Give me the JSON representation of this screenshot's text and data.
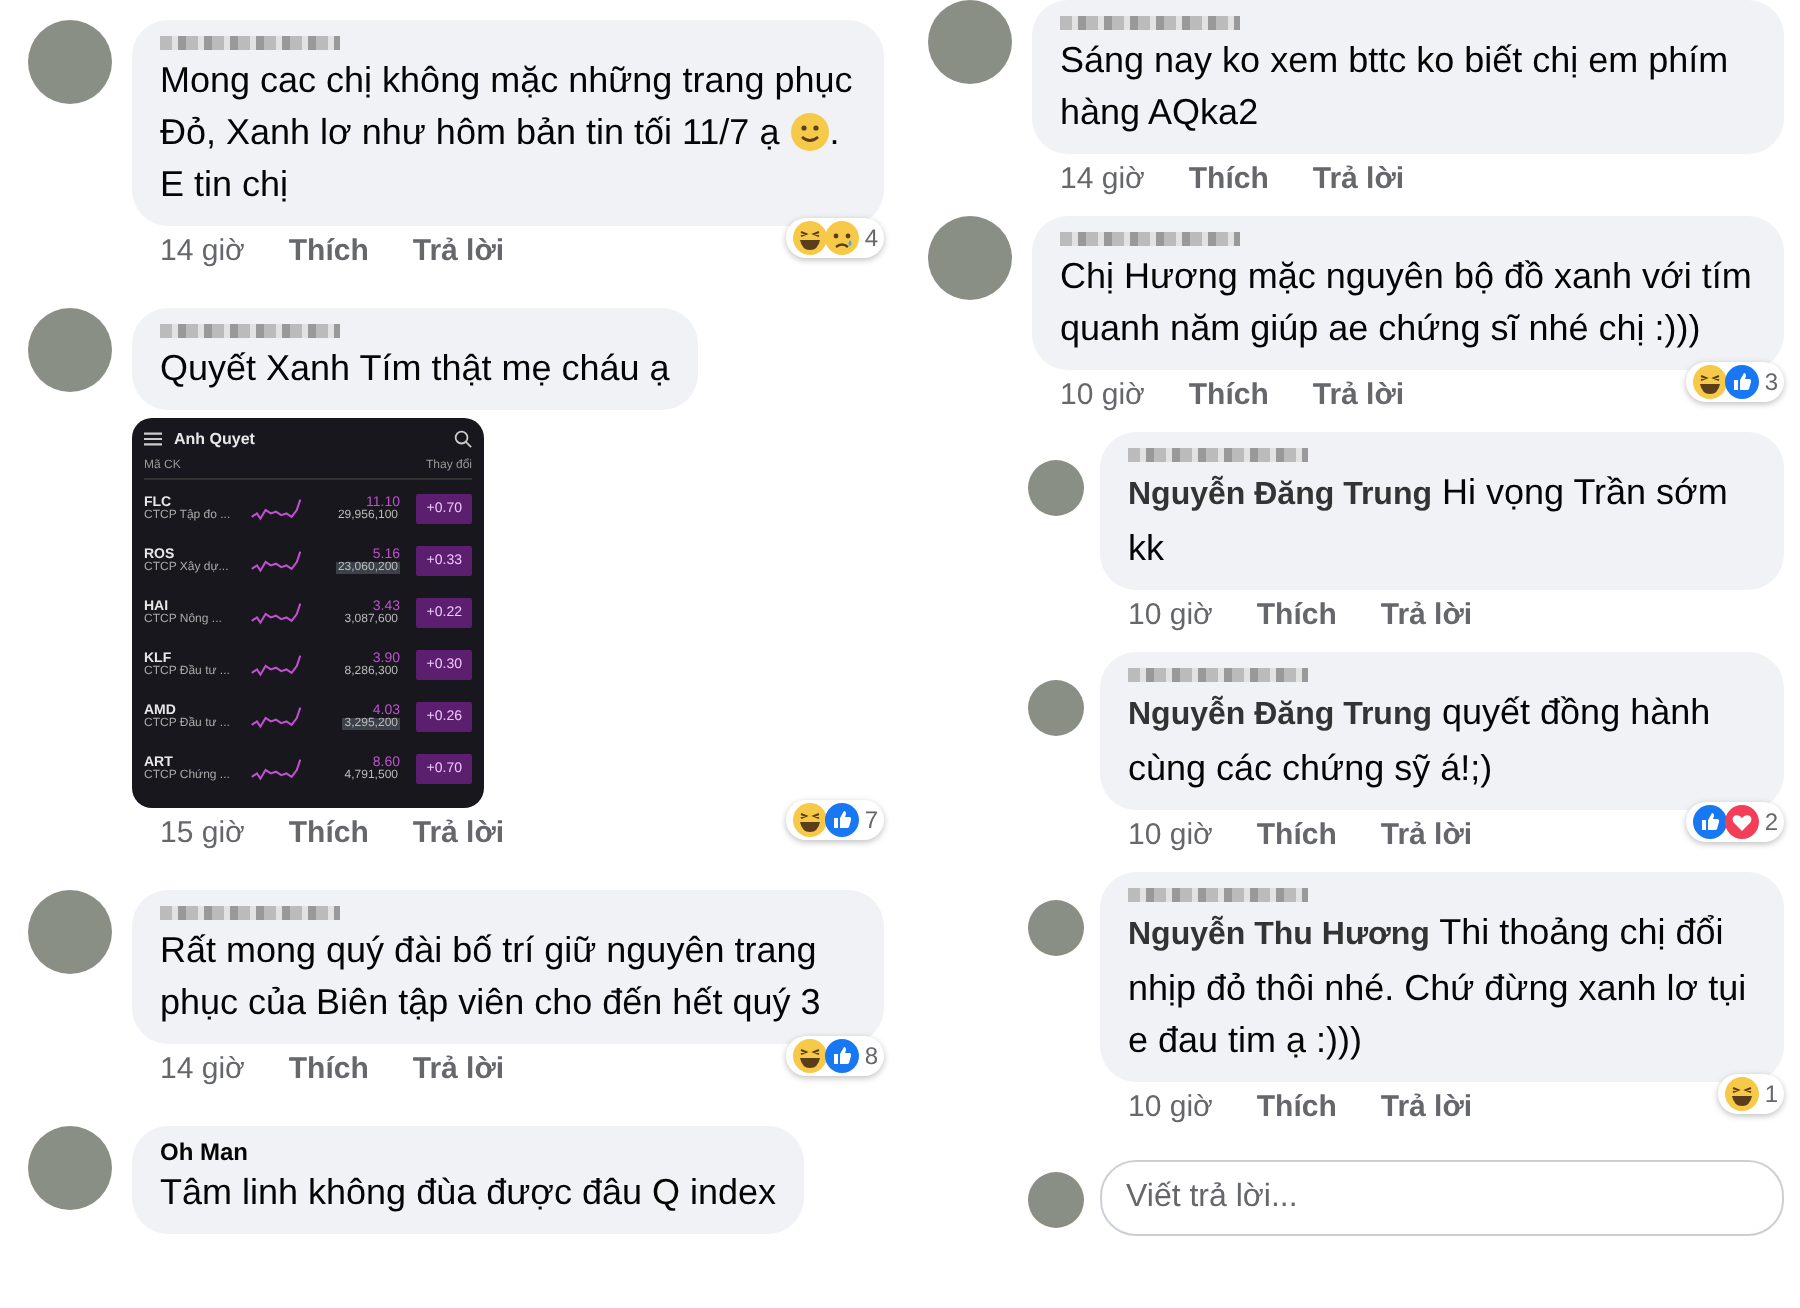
{
  "columns": [
    {
      "comments": [
        {
          "kind": "comment",
          "name_hidden": true,
          "text": [
            {
              "kind": "text",
              "value": "Mong cac chị không mặc những trang phục Đỏ, Xanh lơ như hôm bản tin tối 11/7 ạ "
            },
            {
              "kind": "emoji"
            },
            {
              "kind": "text",
              "value": ". E tin chị"
            }
          ],
          "time": "14 giờ",
          "like": "Thích",
          "reply": "Trả lời",
          "reactions": [
            {
              "kind": "haha"
            },
            {
              "kind": "sad"
            }
          ],
          "reaction_count": "4"
        },
        {
          "kind": "comment",
          "name_hidden": true,
          "text": [
            {
              "kind": "text",
              "value": "Quyết Xanh Tím thật mẹ cháu ạ"
            }
          ],
          "attachment": {
            "title": "Anh Quyet",
            "headers": [
              "Mã CK",
              "Thay đổi"
            ],
            "rows": [
              {
                "ticker": "FLC",
                "company": "CTCP Tập đo ...",
                "price": "11.10",
                "volume": "29,956,100",
                "highlighted": false,
                "change": "+0.70"
              },
              {
                "ticker": "ROS",
                "company": "CTCP Xây dự...",
                "price": "5.16",
                "volume": "23,060,200",
                "highlighted": true,
                "change": "+0.33"
              },
              {
                "ticker": "HAI",
                "company": "CTCP Nông ...",
                "price": "3.43",
                "volume": "3,087,600",
                "highlighted": false,
                "change": "+0.22"
              },
              {
                "ticker": "KLF",
                "company": "CTCP Đầu tư ...",
                "price": "3.90",
                "volume": "8,286,300",
                "highlighted": false,
                "change": "+0.30"
              },
              {
                "ticker": "AMD",
                "company": "CTCP Đầu tư ...",
                "price": "4.03",
                "volume": "3,295,200",
                "highlighted": true,
                "change": "+0.26"
              },
              {
                "ticker": "ART",
                "company": "CTCP Chứng ...",
                "price": "8.60",
                "volume": "4,791,500",
                "highlighted": false,
                "change": "+0.70"
              }
            ]
          },
          "time": "15 giờ",
          "like": "Thích",
          "reply": "Trả lời",
          "reactions": [
            {
              "kind": "haha"
            },
            {
              "kind": "like"
            }
          ],
          "reaction_count": "7"
        },
        {
          "kind": "comment",
          "name_hidden": true,
          "text": [
            {
              "kind": "text",
              "value": "Rất mong quý đài bố trí giữ nguyên trang phục của Biên tập viên cho đến hết quý 3"
            }
          ],
          "time": "14 giờ",
          "like": "Thích",
          "reply": "Trả lời",
          "reactions": [
            {
              "kind": "haha"
            },
            {
              "kind": "like"
            }
          ],
          "reaction_count": "8"
        },
        {
          "kind": "comment",
          "name_hidden": false,
          "name": "Oh Man",
          "text": [
            {
              "kind": "text",
              "value": "Tâm linh không đùa được đâu Q index"
            }
          ]
        }
      ]
    },
    {
      "comments": [
        {
          "kind": "comment",
          "name_hidden": true,
          "text": [
            {
              "kind": "text",
              "value": "Sáng nay ko xem bttc ko biết chị em phím hàng AQka2"
            }
          ],
          "time": "14 giờ",
          "like": "Thích",
          "reply": "Trả lời"
        },
        {
          "kind": "comment",
          "name_hidden": true,
          "text": [
            {
              "kind": "text",
              "value": "Chị Hương mặc nguyên bộ đồ xanh với tím quanh năm giúp ae chứng sĩ nhé chị :)))"
            }
          ],
          "time": "10 giờ",
          "like": "Thích",
          "reply": "Trả lời",
          "reactions": [
            {
              "kind": "haha"
            },
            {
              "kind": "like"
            }
          ],
          "reaction_count": "3"
        },
        {
          "kind": "reply",
          "name_hidden": true,
          "text": [
            {
              "kind": "mention",
              "value": "Nguyễn Đăng Trung"
            },
            {
              "kind": "text",
              "value": " Hi vọng Trần sớm kk"
            }
          ],
          "time": "10 giờ",
          "like": "Thích",
          "reply": "Trả lời"
        },
        {
          "kind": "reply",
          "name_hidden": true,
          "text": [
            {
              "kind": "mention",
              "value": "Nguyễn Đăng Trung"
            },
            {
              "kind": "text",
              "value": " quyết đồng hành cùng các chứng sỹ á!;)"
            }
          ],
          "time": "10 giờ",
          "like": "Thích",
          "reply": "Trả lời",
          "reactions": [
            {
              "kind": "like"
            },
            {
              "kind": "love"
            }
          ],
          "reaction_count": "2"
        },
        {
          "kind": "reply",
          "name_hidden": true,
          "text": [
            {
              "kind": "mention",
              "value": "Nguyễn Thu Hương"
            },
            {
              "kind": "text",
              "value": " Thi thoảng chị đổi nhịp đỏ thôi nhé. Chứ đừng xanh lơ tụi e đau tim ạ :)))"
            }
          ],
          "time": "10 giờ",
          "like": "Thích",
          "reply": "Trả lời",
          "reactions": [
            {
              "kind": "haha"
            }
          ],
          "reaction_count": "1"
        }
      ],
      "reply_box": {
        "placeholder": "Viết trả lời..."
      }
    }
  ]
}
